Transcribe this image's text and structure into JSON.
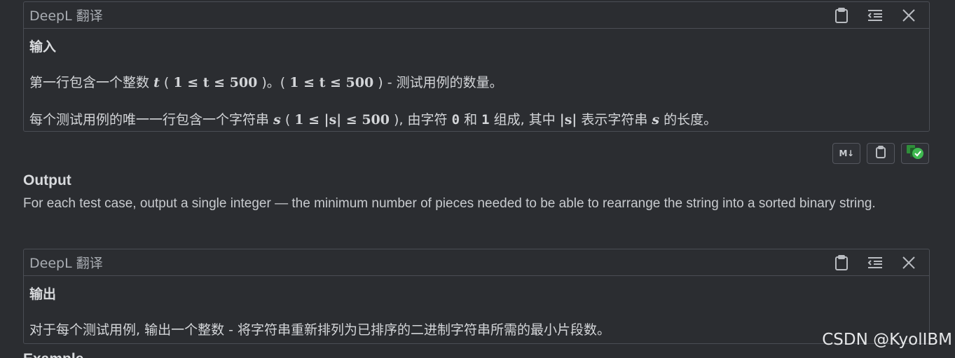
{
  "input_translation": {
    "title": "DeepL 翻译",
    "heading": "输入",
    "line1": {
      "prefix": "第一行包含一个整数",
      "var_t": "t",
      "range_open": "(",
      "range_math": "1 ≤ t ≤ 500",
      "range_close": ")。(",
      "range_math2": "1 ≤ t ≤ 500",
      "suffix": ") - 测试用例的数量。"
    },
    "line2": {
      "prefix": "每个测试用例的唯一一行包含一个字符串",
      "var_s": "s",
      "open": "(",
      "range_math": "1 ≤ |s| ≤ 500",
      "mid": "), 由字符",
      "char0": "0",
      "and": "和",
      "char1": "1",
      "mid2": "组成, 其中",
      "abs_s": "|s|",
      "mid3": "表示字符串",
      "var_s2": "s",
      "suffix": "的长度。"
    },
    "icons": [
      "clipboard-icon",
      "indent-icon",
      "close-icon"
    ]
  },
  "toolbar": {
    "md_label": "M↓",
    "icons": [
      "markdown-icon",
      "clipboard-icon",
      "translate-check-icon"
    ],
    "accent_color": "#3fb950"
  },
  "output_section": {
    "title": "Output",
    "text": "For each test case, output a single integer — the minimum number of pieces needed to be able to rearrange the string into a sorted binary string."
  },
  "output_translation": {
    "title": "DeepL 翻译",
    "heading": "输出",
    "text": "对于每个测试用例, 输出一个整数 - 将字符串重新排列为已排序的二进制字符串所需的最小片段数。",
    "icons": [
      "clipboard-icon",
      "indent-icon",
      "close-icon"
    ]
  },
  "next_section": {
    "title": "Example"
  },
  "watermark": "CSDN @KyolIBM"
}
